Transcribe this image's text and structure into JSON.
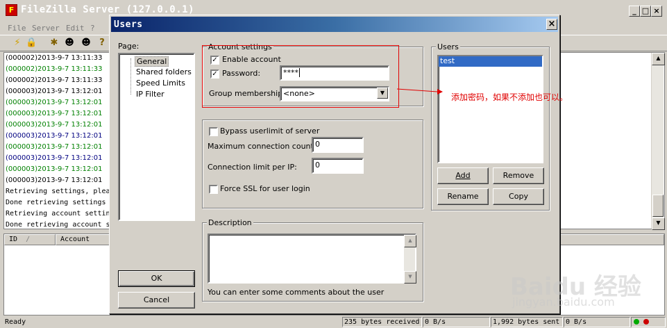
{
  "app": {
    "title": "FileZilla Server (127.0.0.1)",
    "icon_letter": "F",
    "menus": [
      "File",
      "Server",
      "Edit",
      "?"
    ]
  },
  "log": {
    "lines": [
      {
        "text": "(000002)2013-9-7 13:11:33",
        "color": "#000000"
      },
      {
        "text": "(000002)2013-9-7 13:11:33",
        "color": "#008000"
      },
      {
        "text": "(000002)2013-9-7 13:11:33",
        "color": "#000000"
      },
      {
        "text": "(000003)2013-9-7 13:12:01",
        "color": "#000000"
      },
      {
        "text": "(000003)2013-9-7 13:12:01",
        "color": "#008000"
      },
      {
        "text": "(000003)2013-9-7 13:12:01",
        "color": "#008000"
      },
      {
        "text": "(000003)2013-9-7 13:12:01",
        "color": "#008000"
      },
      {
        "text": "(000003)2013-9-7 13:12:01",
        "color": "#000080"
      },
      {
        "text": "(000003)2013-9-7 13:12:01",
        "color": "#008000"
      },
      {
        "text": "(000003)2013-9-7 13:12:01",
        "color": "#000080"
      },
      {
        "text": "(000003)2013-9-7 13:12:01",
        "color": "#008000"
      },
      {
        "text": "(000003)2013-9-7 13:12:01",
        "color": "#000000"
      }
    ],
    "status_lines": [
      "Retrieving settings, plea",
      "Done retrieving settings",
      "Retrieving account settin",
      "Done retrieving account s"
    ]
  },
  "connections": {
    "columns": [
      "ID",
      "Account"
    ],
    "sort_indicator": "/"
  },
  "statusbar": {
    "ready": "Ready",
    "received": "235 bytes received",
    "recv_rate": "0 B/s",
    "sent": "1,992 bytes sent",
    "sent_rate": "0 B/s"
  },
  "dialog": {
    "title": "Users",
    "close_glyph": "×",
    "page_label": "Page:",
    "pages": [
      "General",
      "Shared folders",
      "Speed Limits",
      "IP Filter"
    ],
    "selected_page": "General",
    "ok_label": "OK",
    "cancel_label": "Cancel",
    "account": {
      "group_title": "Account settings",
      "enable_label": "Enable account",
      "enable_checked": true,
      "password_label": "Password:",
      "password_checked": true,
      "password_value": "****",
      "group_membership_label": "Group membership:",
      "group_membership_value": "<none>"
    },
    "limits": {
      "bypass_label": "Bypass userlimit of server",
      "bypass_checked": false,
      "max_conn_label": "Maximum connection count:",
      "max_conn_value": "0",
      "conn_per_ip_label": "Connection limit per IP:",
      "conn_per_ip_value": "0",
      "force_ssl_label": "Force SSL for user login",
      "force_ssl_checked": false
    },
    "description": {
      "group_title": "Description",
      "hint": "You can enter some comments about the user"
    },
    "users": {
      "group_title": "Users",
      "list": [
        "test"
      ],
      "selected": "test",
      "add_label": "Add",
      "remove_label": "Remove",
      "rename_label": "Rename",
      "copy_label": "Copy"
    }
  },
  "annotation": {
    "text": "添加密码，如果不添加也可以。",
    "color": "#e00000"
  },
  "watermark": {
    "brand": "Baidu 经验",
    "url": "jingyan.baidu.com"
  }
}
